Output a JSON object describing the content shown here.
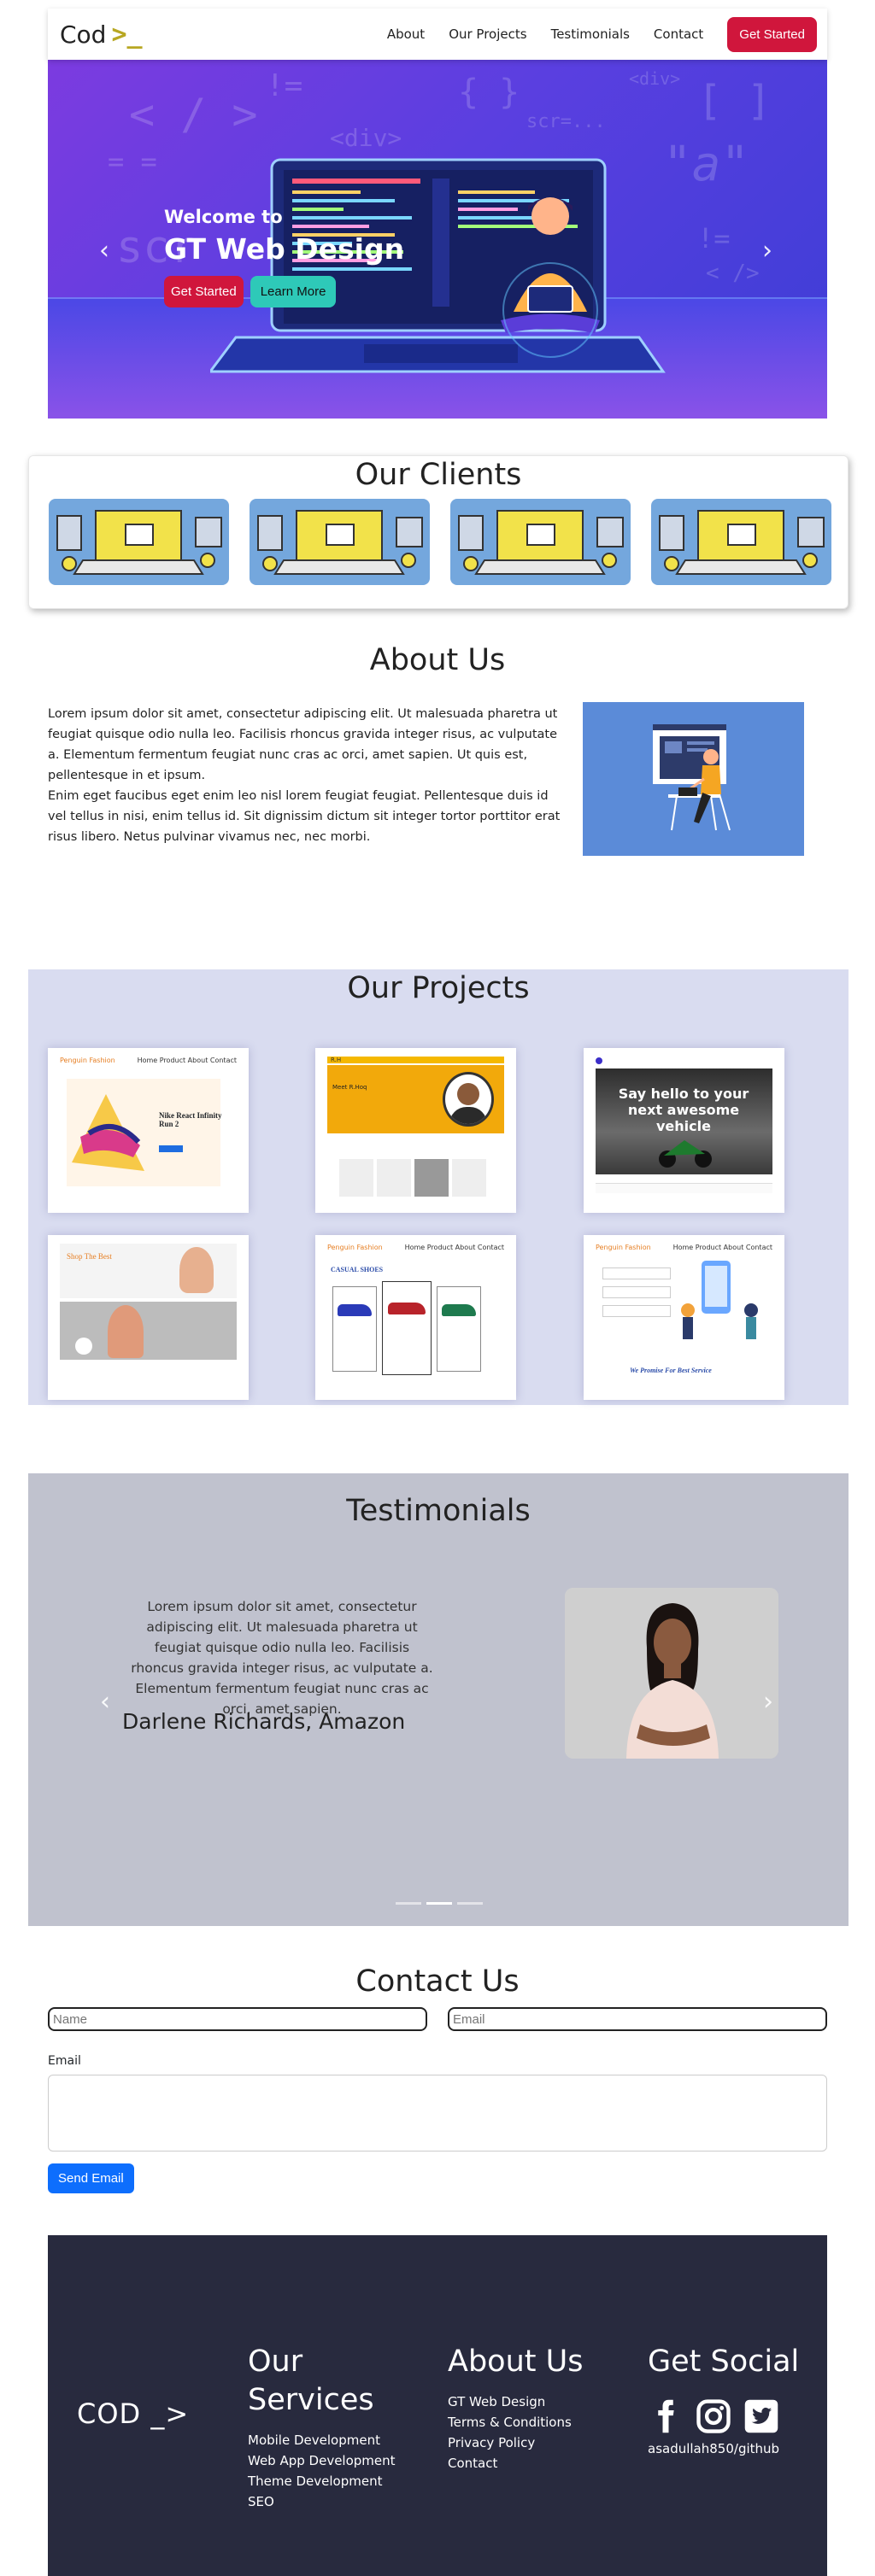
{
  "navbar": {
    "brand_text": "Cod",
    "brand_mark": ">_",
    "links": [
      "About",
      "Our Projects",
      "Testimonials",
      "Contact"
    ],
    "cta": "Get Started"
  },
  "hero": {
    "welcome": "Welcome to",
    "title": "GT Web Design",
    "btn_primary": "Get Started",
    "btn_secondary": "Learn More",
    "prev_icon": "‹",
    "next_icon": "›"
  },
  "clients": {
    "title": "Our Clients"
  },
  "about": {
    "title": "About Us",
    "paragraph1": "Lorem ipsum dolor sit amet, consectetur adipiscing elit. Ut malesuada pharetra ut feugiat quisque odio nulla leo. Facilisis rhoncus gravida integer risus, ac vulputate a. Elementum fermentum feugiat nunc cras ac orci, amet sapien. Ut quis est, pellentesque in et ipsum.",
    "paragraph2": "Enim eget faucibus eget enim leo nisl lorem feugiat feugiat. Pellentesque duis id vel tellus in nisi, enim tellus id. Sit dignissim dictum sit integer tortor porttitor erat risus libero. Netus pulvinar vivamus nec, nec morbi."
  },
  "projects": {
    "title": "Our Projects",
    "items": [
      {
        "brand": "Penguin Fashion",
        "headline": "Nike React Infinity Run 2"
      },
      {
        "brand": "R.H",
        "headline": "Meet R.Hoq"
      },
      {
        "brand": "",
        "headline": "Say hello to your next awesome vehicle"
      },
      {
        "brand": "",
        "headline": "Shop The Best"
      },
      {
        "brand": "Penguin Fashion",
        "headline": "CASUAL SHOES"
      },
      {
        "brand": "Penguin Fashion",
        "headline": "We Promise For Best Service"
      }
    ]
  },
  "testimonials": {
    "title": "Testimonials",
    "quote": "Lorem ipsum dolor sit amet, consectetur adipiscing elit. Ut malesuada pharetra ut feugiat quisque odio nulla leo. Facilisis rhoncus gravida integer risus, ac vulputate a. Elementum fermentum feugiat nunc cras ac orci, amet sapien.",
    "author": "Darlene Richards, Amazon",
    "active_index": 1,
    "prev_icon": "‹",
    "next_icon": "›"
  },
  "contact": {
    "title": "Contact Us",
    "name_placeholder": "Name",
    "email_placeholder": "Email",
    "email_label": "Email",
    "submit": "Send Email"
  },
  "footer": {
    "logo": "COD _>",
    "services_title": "Our Services",
    "services": [
      "Mobile Development",
      "Web App Development",
      "Theme Development",
      "SEO"
    ],
    "about_title": "About Us",
    "about_links": [
      "GT Web Design",
      "Terms & Conditions",
      "Privacy Policy",
      "Contact"
    ],
    "social_title": "Get Social",
    "social_icons": [
      "facebook-icon",
      "instagram-icon",
      "twitter-icon"
    ],
    "handle": "asadullah850/github"
  },
  "colors": {
    "accent_red": "#d0163c",
    "accent_teal": "#2ec9b8",
    "brand_mark": "#b8a722",
    "projects_bg": "#d9dcf0",
    "testimonials_bg": "#c0c2ce",
    "footer_bg": "#282a3e",
    "send_button": "#0d6efd"
  }
}
